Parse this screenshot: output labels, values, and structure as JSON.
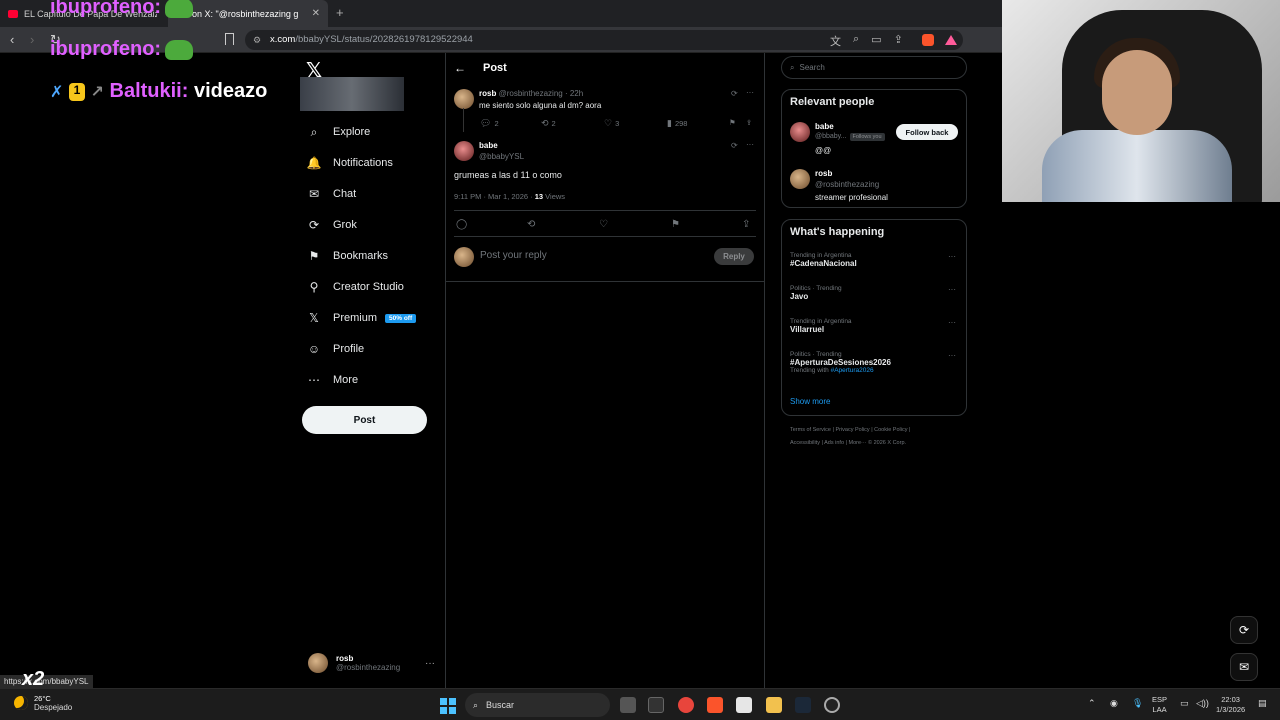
{
  "browser": {
    "tabs": [
      {
        "title": "EL Capítulo De Papa De Wenzaiz - ...",
        "fav_color": "#ff0033"
      },
      {
        "title": "on X: \"@rosbinthezazing g",
        "fav_color": "#1d9bf0"
      }
    ],
    "url_host": "x.com",
    "url_path": "/bbabyYSL/status/2028261978129522944",
    "new_tab": "+",
    "close": "✕"
  },
  "overlay": {
    "chat": [
      {
        "user": "ibuprofeno:",
        "msg": ""
      },
      {
        "user": "ibuprofeno:",
        "msg": ""
      },
      {
        "user": "Baltukii:",
        "msg": "videazo",
        "badge": "1"
      }
    ],
    "status_url": "https://x.com/bbabyYSL",
    "x2": "x2"
  },
  "nav": {
    "logo": "𝕏",
    "items": [
      {
        "label": "Explore",
        "icon": "⌕"
      },
      {
        "label": "Notifications",
        "icon": "🔔"
      },
      {
        "label": "Chat",
        "icon": "✉"
      },
      {
        "label": "Grok",
        "icon": "⟳"
      },
      {
        "label": "Bookmarks",
        "icon": "⚑"
      },
      {
        "label": "Creator Studio",
        "icon": "⚲"
      },
      {
        "label": "Premium",
        "icon": "𝕏"
      },
      {
        "label": "Profile",
        "icon": "☺"
      },
      {
        "label": "More",
        "icon": "⋯"
      }
    ],
    "premium_promo": "50% off",
    "post_button": "Post",
    "account": {
      "name": "rosb",
      "handle": "@rosbinthezazing",
      "more": "···"
    }
  },
  "post_page": {
    "back": "←",
    "title": "Post",
    "parent": {
      "name": "rosb",
      "handle_time": "@rosbinthezazing · 22h",
      "text": "me siento solo alguna al dm? aora",
      "replies": "2",
      "reposts": "2",
      "likes": "3",
      "views": "298",
      "more": "···"
    },
    "main": {
      "name": "babe",
      "handle": "@bbabyYSL",
      "text": "grumeas a las d 11 o como",
      "meta_time": "9:11 PM · Mar 1, 2026 · ",
      "views_count": "13",
      "views_label": " Views",
      "more": "···"
    },
    "reply_placeholder": "Post your reply",
    "reply_button": "Reply"
  },
  "sidebar": {
    "search_placeholder": "Search",
    "relevant": {
      "title": "Relevant people",
      "people": [
        {
          "name": "babe",
          "handle": "@bbaby...",
          "follows_you": "Follows you",
          "bio": "@@",
          "action": "Follow back"
        },
        {
          "name": "rosb",
          "handle": "@rosbinthezazing",
          "bio": "streamer profesional"
        }
      ]
    },
    "happening": {
      "title": "What's happening",
      "trends": [
        {
          "meta": "Trending in Argentina",
          "name": "#CadenaNacional",
          "with": ""
        },
        {
          "meta": "Politics · Trending",
          "name": "Javo",
          "with": ""
        },
        {
          "meta": "Trending in Argentina",
          "name": "Villarruel",
          "with": ""
        },
        {
          "meta": "Politics · Trending",
          "name": "#AperturaDeSesiones2026",
          "with_label": "Trending with ",
          "with": "#Apertura2026"
        }
      ],
      "show_more": "Show more"
    },
    "footer": {
      "line1": "Terms of Service  |  Privacy Policy  |  Cookie Policy  |",
      "line2": "Accessibility  |  Ads info  |  More···  © 2026 X Corp."
    }
  },
  "taskbar": {
    "temp": "26°C",
    "condition": "Despejado",
    "search": "Buscar",
    "lang1": "ESP",
    "lang2": "LAA",
    "time": "22:03",
    "date": "1/3/2026"
  }
}
